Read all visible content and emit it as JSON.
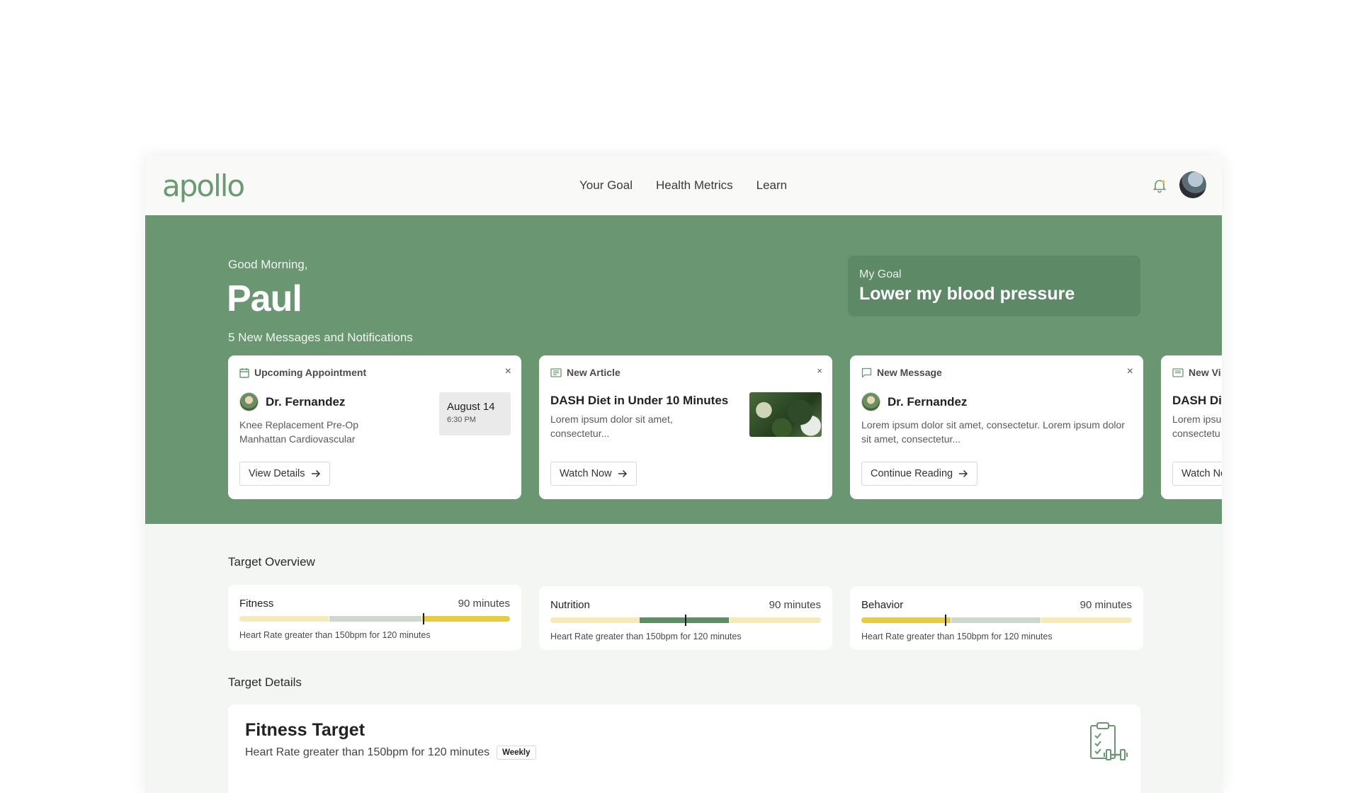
{
  "app": {
    "logo": "apollo"
  },
  "nav": [
    "Your Goal",
    "Health Metrics",
    "Learn"
  ],
  "colors": {
    "brand": "#6a9772",
    "yellow": "#e6cc44",
    "pale_yellow": "#f5eab9",
    "gray_green": "#cfd8cf",
    "dark_green": "#5f8d67"
  },
  "hero": {
    "greeting": "Good Morning,",
    "name": "Paul",
    "notifications": "5 New Messages and Notifications",
    "goal_label": "My Goal",
    "goal_value": "Lower my blood pressure"
  },
  "cards": [
    {
      "type": "Upcoming Appointment",
      "icon": "calendar-icon",
      "doctor": "Dr. Fernandez",
      "lines": [
        "Knee Replacement Pre-Op",
        "Manhattan Cardiovascular"
      ],
      "date": "August 14",
      "time": "6:30 PM",
      "button": "View Details",
      "close": "×"
    },
    {
      "type": "New Article",
      "icon": "newspaper-icon",
      "title": "DASH Diet in Under 10 Minutes",
      "body": "Lorem ipsum dolor sit amet, consectetur...",
      "button": "Watch Now",
      "close": "×"
    },
    {
      "type": "New Message",
      "icon": "message-icon",
      "doctor": "Dr. Fernandez",
      "body": "Lorem ipsum dolor sit amet, consectetur. Lorem ipsum dolor sit amet, consectetur...",
      "button": "Continue Reading",
      "close": "×"
    },
    {
      "type": "New Vi",
      "icon": "newspaper-icon",
      "title": "DASH Diet",
      "body": "Lorem ipsu consectetu",
      "button": "Watch No"
    }
  ],
  "target_overview": {
    "title": "Target Overview",
    "items": [
      {
        "name": "Fitness",
        "minutes": "90 minutes",
        "desc": "Heart Rate greater than 150bpm for 120 minutes",
        "marker": 0.68
      },
      {
        "name": "Nutrition",
        "minutes": "90 minutes",
        "desc": "Heart Rate greater than 150bpm for 120 minutes",
        "marker": 0.5
      },
      {
        "name": "Behavior",
        "minutes": "90 minutes",
        "desc": "Heart Rate greater than 150bpm for 120 minutes",
        "marker": 0.31
      }
    ]
  },
  "target_details": {
    "title": "Target Details",
    "card_title": "Fitness Target",
    "card_sub": "Heart Rate greater than 150bpm for 120 minutes",
    "badge": "Weekly"
  }
}
